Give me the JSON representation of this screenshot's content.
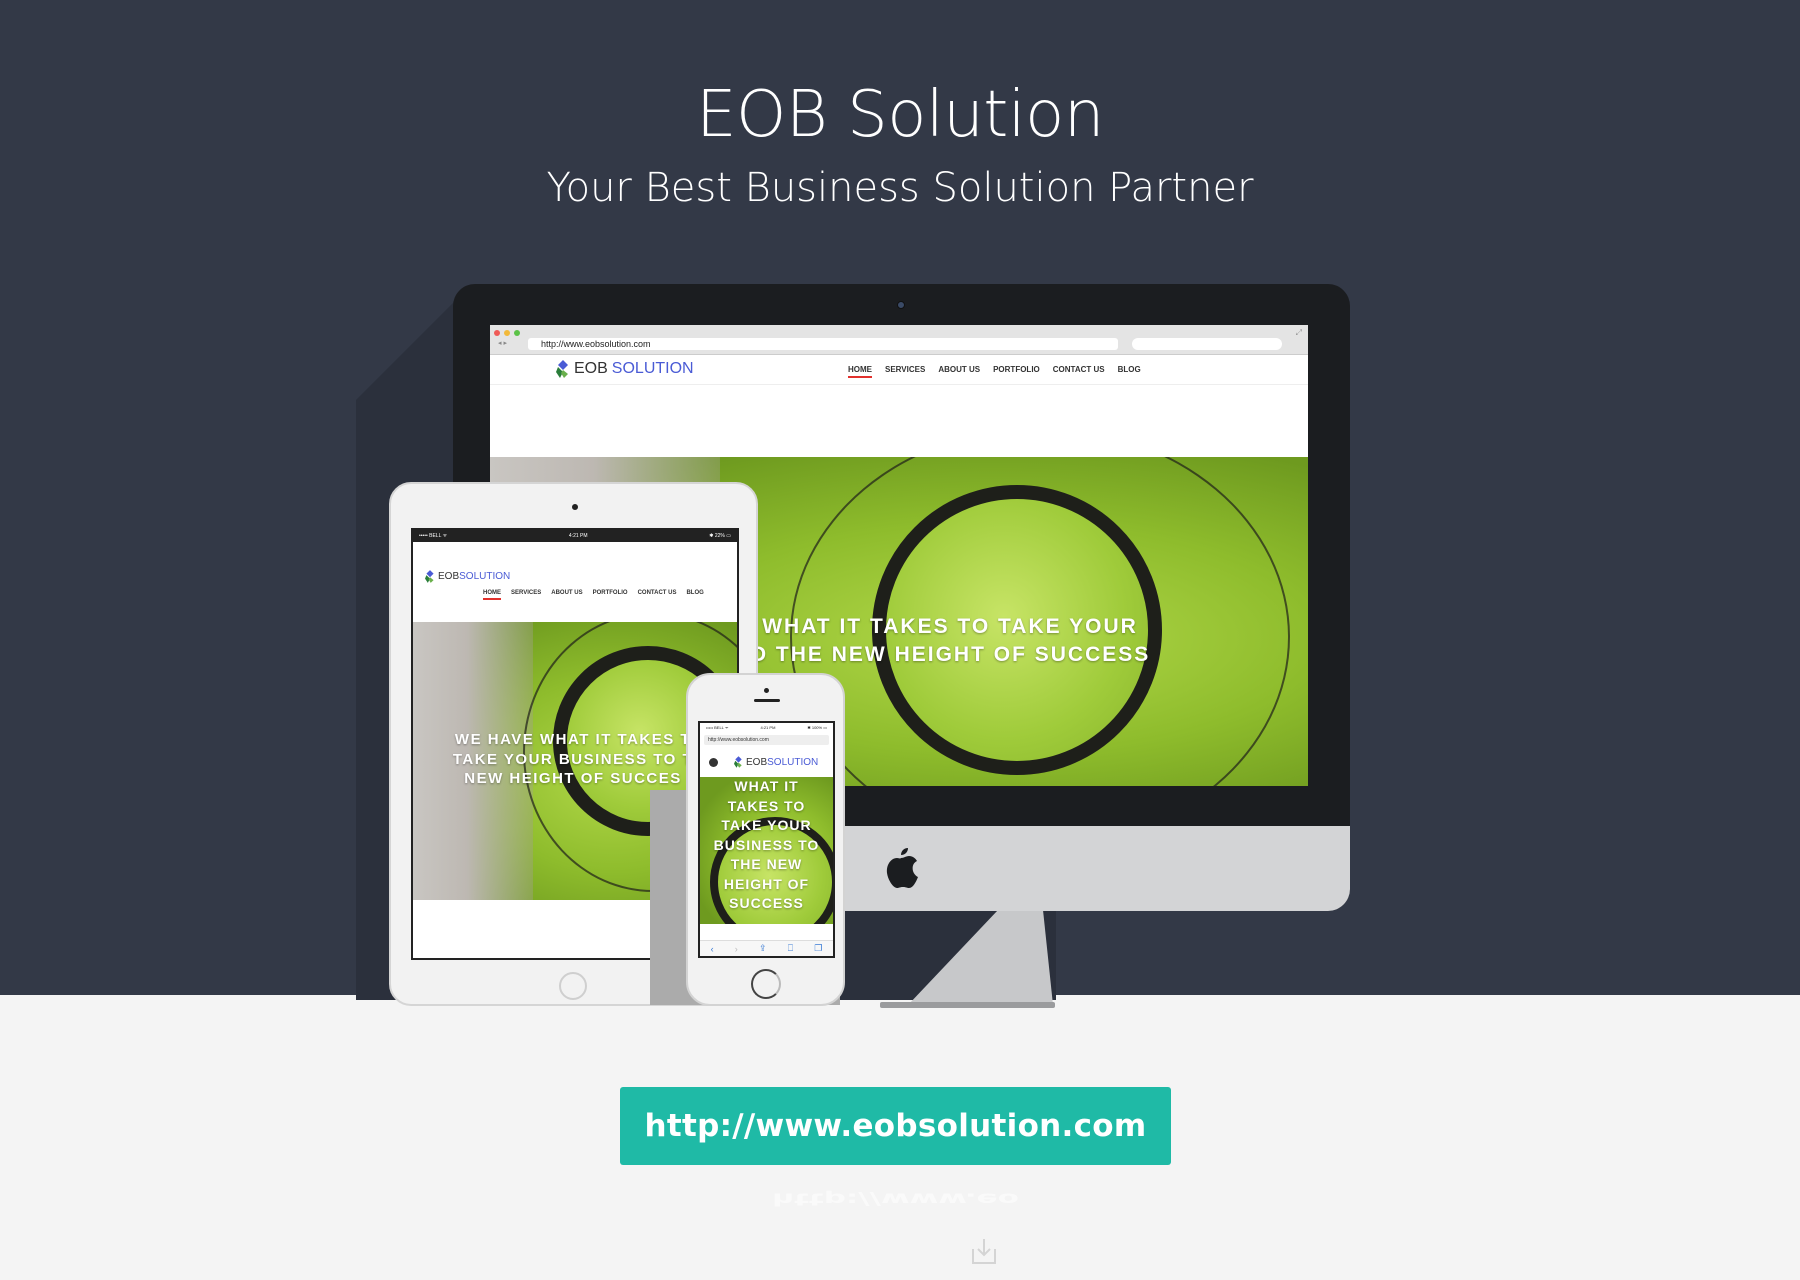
{
  "page": {
    "title": "EOB Solution",
    "subtitle": "Your Best Business Solution Partner",
    "cta_url": "http://www.eobsolution.com",
    "cta_reflection": "http://www.eo"
  },
  "desktop": {
    "address": "http://www.eobsolution.com",
    "logo_eob": "EOB",
    "logo_solution": "SOLUTION",
    "nav": [
      "HOME",
      "SERVICES",
      "ABOUT US",
      "PORTFOLIO",
      "CONTACT US",
      "BLOG"
    ],
    "headline_line1": "WHAT IT TAKES TO TAKE YOUR",
    "headline_line2": "O THE NEW HEIGHT OF SUCCESS"
  },
  "tablet": {
    "carrier": "••••• BELL ᯤ",
    "time": "4:21 PM",
    "battery": "✱ 22% ▭",
    "logo_eob": "EOB",
    "logo_solution": "SOLUTION",
    "nav": [
      "HOME",
      "SERVICES",
      "ABOUT US",
      "PORTFOLIO",
      "CONTACT US",
      "BLOG"
    ],
    "headline_line1": "WE HAVE WHAT IT TAKES T",
    "headline_line2": "TAKE YOUR BUSINESS TO T",
    "headline_line3": "NEW HEIGHT OF SUCCES"
  },
  "phone": {
    "carrier": "••••• BELL ᯤ",
    "time": "4:21 PM",
    "battery": "✱ 100% ▭",
    "address": "http://www.eobsolution.com",
    "logo_eob": "EOB",
    "logo_solution": "SOLUTION",
    "headline": [
      "WHAT IT",
      "TAKES TO",
      "TAKE YOUR",
      "BUSINESS TO",
      "THE NEW",
      "HEIGHT OF",
      "SUCCESS"
    ]
  },
  "colors": {
    "hero_bg": "#333947",
    "cta": "#1fbaa6",
    "logo_blue": "#4a5bd5",
    "nav_active": "#e2312d",
    "photo_green": "#9fcb3a"
  },
  "icons": {
    "apple": "apple-logo-icon",
    "download": "download-icon",
    "logo_mark": "eob-logo-mark-icon"
  }
}
